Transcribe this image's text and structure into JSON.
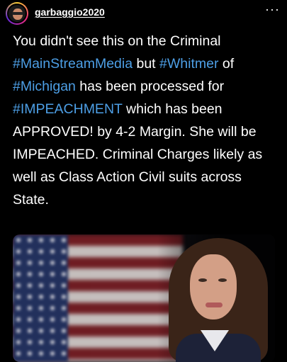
{
  "header": {
    "username": "garbaggio2020",
    "more_icon": "more-horizontal-icon",
    "more_glyph": "···"
  },
  "post": {
    "segments": [
      {
        "text": "You didn't see this on the Criminal ",
        "hashtag": false
      },
      {
        "text": "#MainStreamMedia",
        "hashtag": true
      },
      {
        "text": " but ",
        "hashtag": false
      },
      {
        "text": "#Whitmer",
        "hashtag": true
      },
      {
        "text": " of ",
        "hashtag": false
      },
      {
        "text": "#Michigan",
        "hashtag": true
      },
      {
        "text": " has been processed for ",
        "hashtag": false
      },
      {
        "text": "#IMPEACHMENT",
        "hashtag": true
      },
      {
        "text": " which has been APPROVED! by 4-2 Margin. She will be IMPEACHED. Criminal Charges likely as well as Class Action Civil suits across State.",
        "hashtag": false
      }
    ]
  },
  "colors": {
    "background": "#000000",
    "text": "#ffffff",
    "hashtag": "#4d9fe6"
  }
}
